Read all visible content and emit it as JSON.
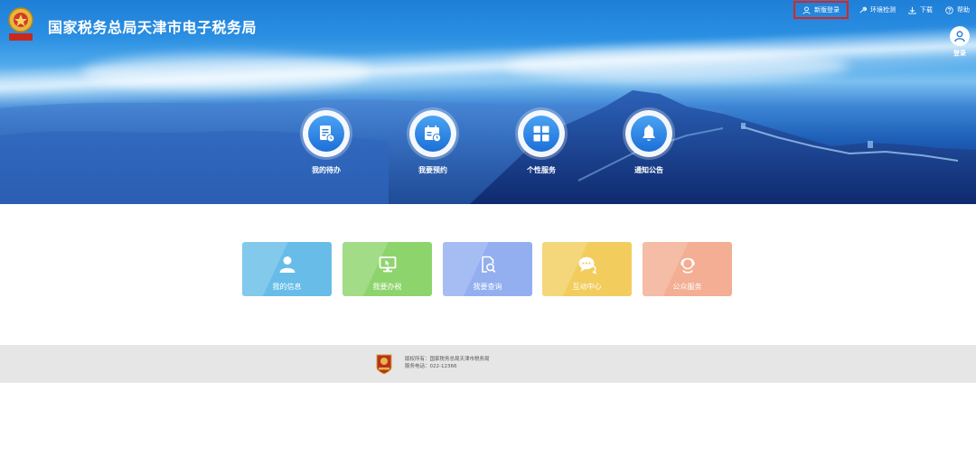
{
  "header": {
    "title": "国家税务总局天津市电子税务局"
  },
  "topnav": [
    {
      "label": "新版登录",
      "icon": "user-icon"
    },
    {
      "label": "环境检测",
      "icon": "wrench-icon"
    },
    {
      "label": "下载",
      "icon": "download-icon"
    },
    {
      "label": "帮助",
      "icon": "help-icon"
    }
  ],
  "login": {
    "label": "登录",
    "icon": "user-circle-icon"
  },
  "quick_links": [
    {
      "label": "我的待办",
      "icon": "todo-list-icon"
    },
    {
      "label": "我要预约",
      "icon": "calendar-clock-icon"
    },
    {
      "label": "个性服务",
      "icon": "grid-icon"
    },
    {
      "label": "通知公告",
      "icon": "bell-icon"
    }
  ],
  "tiles": [
    {
      "label": "我的信息",
      "icon": "person-icon",
      "color": "#67bde8"
    },
    {
      "label": "我要办税",
      "icon": "monitor-icon",
      "color": "#8ed46c"
    },
    {
      "label": "我要查询",
      "icon": "search-document-icon",
      "color": "#93aff0"
    },
    {
      "label": "互动中心",
      "icon": "chat-icon",
      "color": "#f2cd5e"
    },
    {
      "label": "公众服务",
      "icon": "service-person-icon",
      "color": "#f3ae93"
    }
  ],
  "footer": {
    "copyright": "版权所有：国家税务总局天津市税务局",
    "phone": "服务电话：022-12366"
  },
  "colors": {
    "highlight_border": "#e0231c",
    "footer_bg": "#e6e6e6"
  }
}
